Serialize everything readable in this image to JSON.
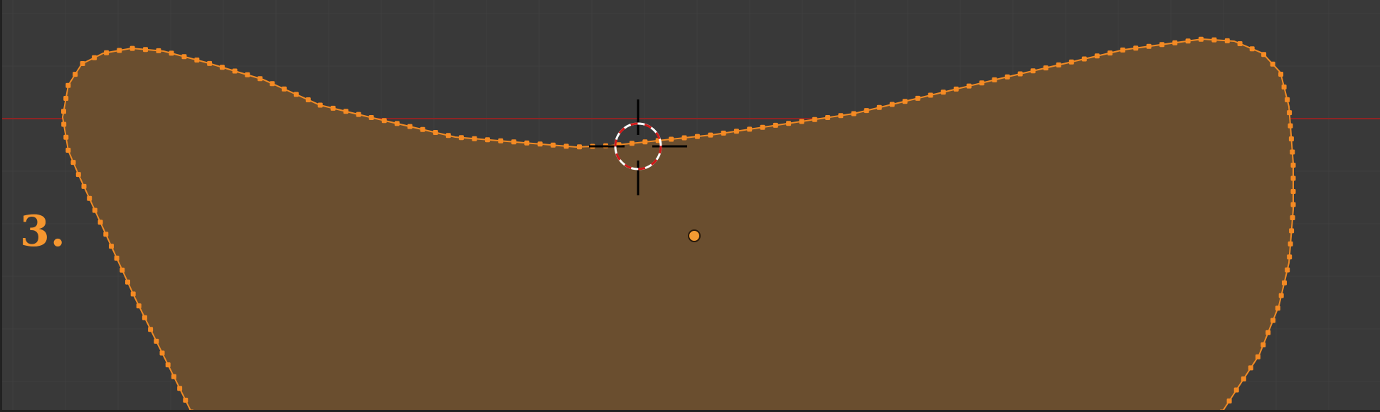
{
  "viewport": {
    "step_label": "3.",
    "colors": {
      "background": "#393939",
      "grid": "#404040",
      "x_axis": "#8f2424",
      "mesh_fill": "#6a4e2f",
      "edge": "#f08a24",
      "vertex": "#f58a23",
      "cursor_ring_red": "#d01818",
      "cursor_ring_white": "#ffffff",
      "cursor_cross": "#000000",
      "origin": "#f39a32",
      "label": "#f5962f"
    },
    "icons": {
      "cursor": "3d-cursor-icon",
      "origin": "object-origin-icon"
    }
  }
}
